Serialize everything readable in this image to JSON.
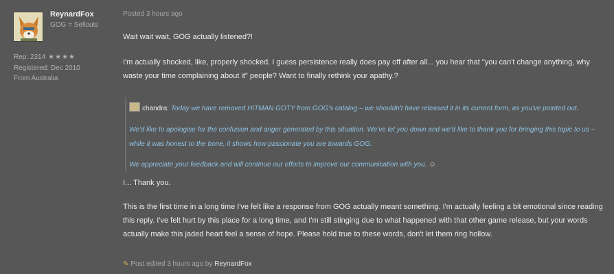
{
  "user": {
    "name": "ReynardFox",
    "group": "GOG = Sellouts",
    "rep_label": "Rep: 2314",
    "rep_stars": "★★★★",
    "registered": "Registered: Dec 2010",
    "location": "From Australia"
  },
  "post": {
    "posted": "Posted 3 hours ago",
    "p1": "Wait wait wait, GOG actually listened?!",
    "p2": "I'm actually shocked, like, properly shocked. I guess persistence really does pay off after all... you hear that \"you can't change anything, why waste your time complaining about it\" people? Want to finally rethink your apathy.?",
    "quote": {
      "author": "chandra:",
      "line1": "Today we have removed HITMAN GOTY from GOG's catalog – we shouldn't have released it in its current form, as you've pointed out.",
      "line2": "We'd like to apologise for the confusion and anger generated by this situation. We've let you down and we'd like to thank you for bringing this topic to us – while it was honest to the bone, it shows how passionate you are towards GOG.",
      "line3": "We appreciate your feedback and will continue our efforts to improve our communication with you.",
      "smiley": "☺"
    },
    "p3": "I... Thank you.",
    "p4": "This is the first time in a long time I've felt like a response from GOG actually meant something. I'm actually feeling a bit emotional since reading this reply. I've felt hurt by this place for a long time, and I'm still stinging due to what happened with that other game release, but your words actually make this jaded heart feel a sense of hope. Please hold true to these words, don't let them ring hollow.",
    "edited_prefix": "Post edited 3 hours ago by",
    "edited_by": "ReynardFox"
  }
}
